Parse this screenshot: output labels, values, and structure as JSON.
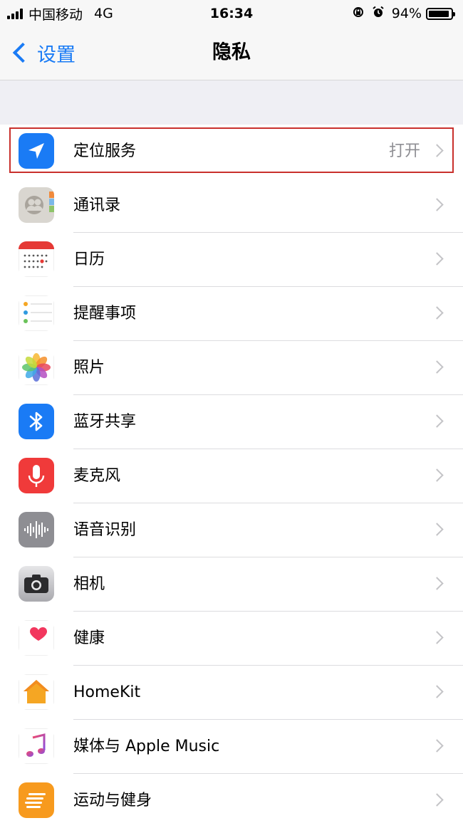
{
  "status_bar": {
    "carrier": "中国移动",
    "network": "4G",
    "time": "16:34",
    "battery": "94%",
    "battery_level": 0.94
  },
  "nav": {
    "back_label": "设置",
    "title": "隐私"
  },
  "colors": {
    "accent": "#1a7bf5",
    "highlight_border": "#c9302c"
  },
  "items": [
    {
      "label": "定位服务",
      "value": "打开",
      "icon": "location-arrow-icon"
    },
    {
      "label": "通讯录",
      "value": "",
      "icon": "contacts-icon"
    },
    {
      "label": "日历",
      "value": "",
      "icon": "calendar-icon"
    },
    {
      "label": "提醒事项",
      "value": "",
      "icon": "reminders-icon"
    },
    {
      "label": "照片",
      "value": "",
      "icon": "photos-icon"
    },
    {
      "label": "蓝牙共享",
      "value": "",
      "icon": "bluetooth-icon"
    },
    {
      "label": "麦克风",
      "value": "",
      "icon": "microphone-icon"
    },
    {
      "label": "语音识别",
      "value": "",
      "icon": "speech-recognition-icon"
    },
    {
      "label": "相机",
      "value": "",
      "icon": "camera-icon"
    },
    {
      "label": "健康",
      "value": "",
      "icon": "health-heart-icon"
    },
    {
      "label": "HomeKit",
      "value": "",
      "icon": "homekit-house-icon"
    },
    {
      "label": "媒体与 Apple Music",
      "value": "",
      "icon": "music-note-icon"
    },
    {
      "label": "运动与健身",
      "value": "",
      "icon": "motion-fitness-icon"
    }
  ]
}
